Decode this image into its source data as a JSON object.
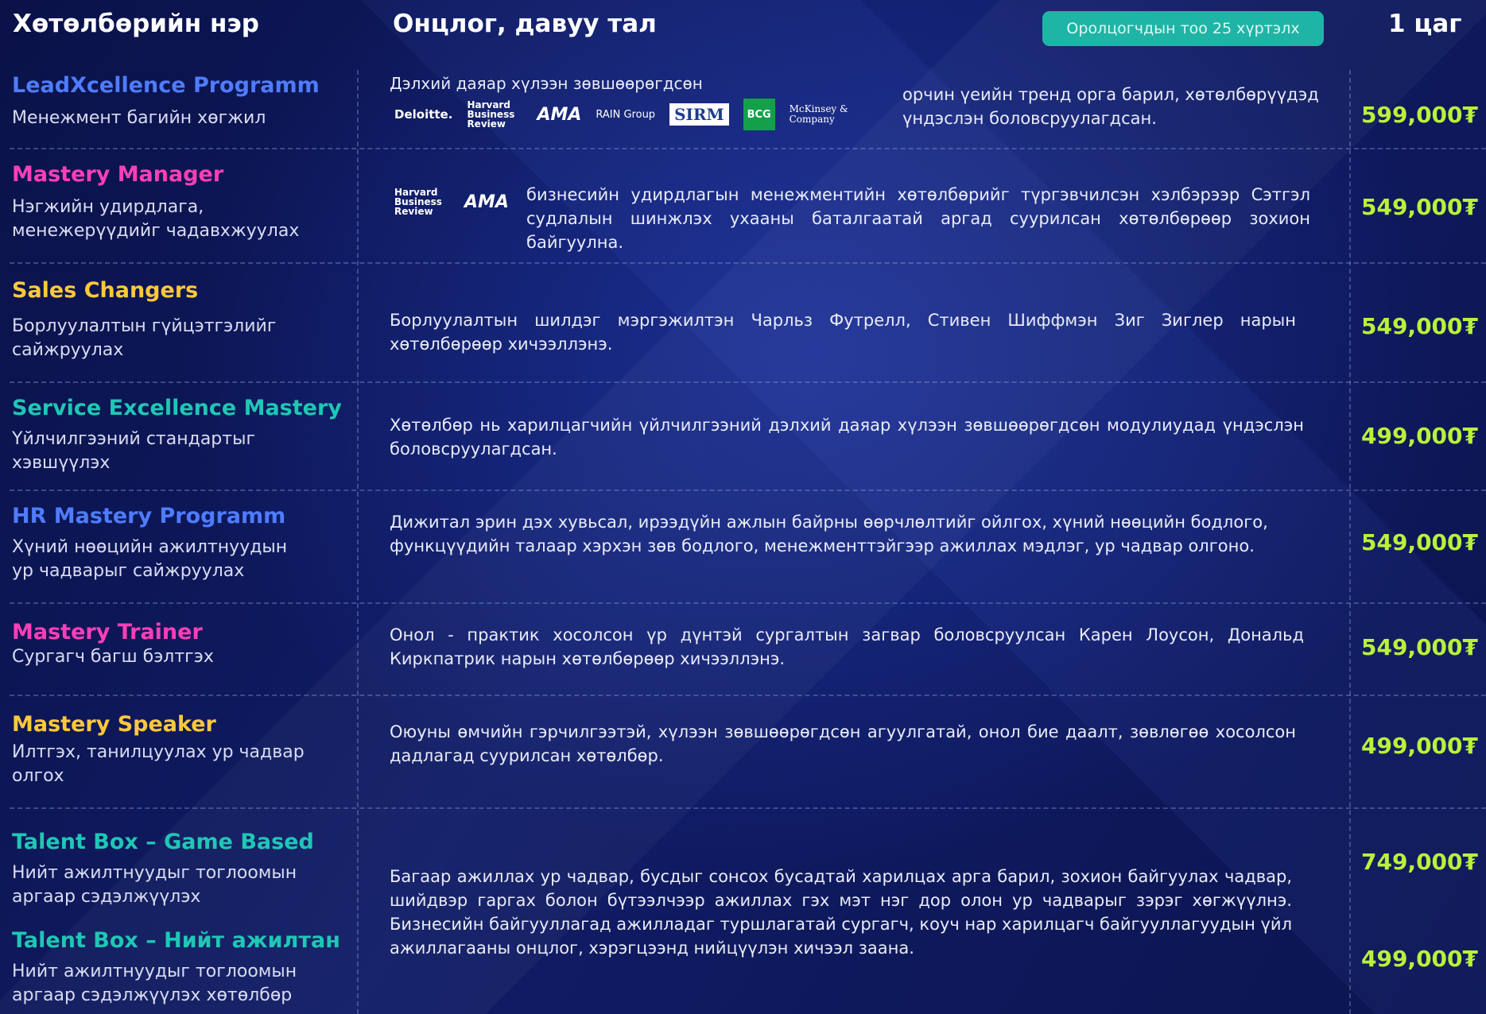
{
  "header": {
    "name_col": "Хөтөлбөрийн нэр",
    "feature_col": "Онцлог, давуу тал",
    "badge": "Оролцогчдын тоо 25 хүртэлх",
    "price_col": "1 цаг"
  },
  "colors": {
    "bg": "#0c1550",
    "price": "#b9f23a",
    "badge": "#1fb5a6",
    "blue": "#4f7cff",
    "pink": "#ff3fb8",
    "yellow": "#ffc93a",
    "teal": "#1fc7b4"
  },
  "programs": [
    {
      "name": "LeadXcellence Programm",
      "name_color": "#4f7cff",
      "subtitle": "Менежмент багийн хөгжил",
      "logo_caption": "Дэлхий даяар хүлээн зөвшөөрөгдсөн",
      "logos": [
        "Deloitte.",
        "Harvard Business Review",
        "AMA",
        "RAIN Group",
        "SIRM",
        "BCG",
        "McKinsey & Company"
      ],
      "desc": "орчин үеийн тренд орга барил, хөтөлбөрүүдэд үндэслэн боловсруулагдсан.",
      "price": "599,000₮"
    },
    {
      "name": "Mastery Manager",
      "name_color": "#ff3fb8",
      "subtitle": "Нэгжийн удирдлага, менежерүүдийг чадавхжуулах",
      "logos": [
        "Harvard Business Review",
        "AMA"
      ],
      "desc": "бизнесийн удирдлагын менежментийн хөтөлбөрийг түргэвчилсэн хэлбэрээр Сэтгэл судлалын шинжлэх ухааны баталгаатай аргад суурилсан хөтөлбөрөөр зохион байгуулна.",
      "price": "549,000₮"
    },
    {
      "name": "Sales Changers",
      "name_color": "#ffc93a",
      "subtitle": "Борлуулалтын гүйцэтгэлийг сайжруулах",
      "desc": "Борлуулалтын шилдэг мэргэжилтэн Чарльз Футрелл, Стивен Шиффмэн Зиг Зиглер нарын хөтөлбөрөөр хичээллэнэ.",
      "price": "549,000₮"
    },
    {
      "name": "Service Excellence Mastery",
      "name_color": "#1fc7b4",
      "subtitle": "Үйлчилгээний стандартыг хэвшүүлэх",
      "desc": "Хөтөлбөр нь харилцагчийн үйлчилгээний дэлхий даяар хүлээн зөвшөөрөгдсөн модулиудад үндэслэн боловсруулагдсан.",
      "price": "499,000₮"
    },
    {
      "name": "HR Mastery Programm",
      "name_color": "#4f7cff",
      "subtitle": "Хүний нөөцийн ажилтнуудын ур чадварыг сайжруулах",
      "desc": "Дижитал эрин дэх хувьсал, ирээдүйн ажлын байрны өөрчлөлтийг ойлгох, хүний нөөцийн бодлого, функцүүдийн талаар хэрхэн зөв бодлого, менежменттэйгээр ажиллах мэдлэг, ур чадвар олгоно.",
      "price": "549,000₮"
    },
    {
      "name": "Mastery Trainer",
      "name_color": "#ff3fb8",
      "subtitle": "Сургагч багш бэлтгэх",
      "desc": "Онол - практик хосолсон үр дүнтэй сургалтын загвар боловсруулсан Карен Лоусон, Дональд Киркпатрик нарын хөтөлбөрөөр хичээллэнэ.",
      "price": "549,000₮"
    },
    {
      "name": "Mastery Speaker",
      "name_color": "#ffc93a",
      "subtitle": "Илтгэх, танилцуулах ур чадвар олгох",
      "desc": "Оюуны өмчийн гэрчилгээтэй, хүлээн зөвшөөрөгдсөн агуулгатай, онол бие даалт, зөвлөгөө хосолсон дадлагад суурилсан хөтөлбөр.",
      "price": "499,000₮"
    }
  ],
  "talent_box": {
    "game": {
      "name": "Talent Box – Game Based",
      "subtitle": "Нийт ажилтнуудыг тоглоомын аргаар сэдэлжүүлэх",
      "price": "749,000₮"
    },
    "all": {
      "name": "Talent Box – Нийт ажилтан",
      "subtitle": "Нийт ажилтнуудыг тоглоомын аргаар сэдэлжүүлэх хөтөлбөр",
      "price": "499,000₮"
    },
    "name_color": "#1fc7b4",
    "desc": "Багаар ажиллах ур чадвар, бусдыг сонсох бусадтай харилцах арга барил, зохион байгуулах чадвар, шийдвэр гаргах болон бүтээлчээр ажиллах гэх мэт нэг дор олон ур чадварыг зэрэг хөгжүүлнэ. Бизнесийн байгууллагад ажилладаг туршлагатай сургагч, коуч нар харилцагч байгууллагуудын үйл ажиллагааны онцлог, хэрэгцээнд нийцүүлэн хичээл заана."
  }
}
